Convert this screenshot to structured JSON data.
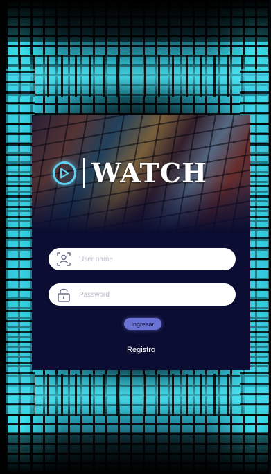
{
  "app": {
    "logo_text": "WATCH"
  },
  "login": {
    "username_placeholder": "User name",
    "password_placeholder": "Password",
    "submit_label": "Ingresar",
    "register_label": "Registro"
  },
  "icons": {
    "logo": "play-circle-icon",
    "username": "user-scan-icon",
    "password": "lock-icon"
  },
  "colors": {
    "card_background": "#0b0d33",
    "accent_cyan": "#5fd0f0",
    "button": "#6b72d6",
    "tile_glow": "#3bd0e2"
  }
}
